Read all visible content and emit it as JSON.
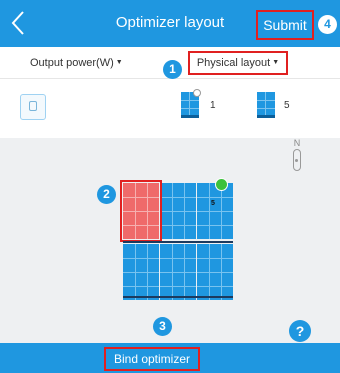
{
  "header": {
    "back_icon": "chevron-left-icon",
    "title": "Optimizer layout",
    "submit_label": "Submit",
    "badge_number": "4"
  },
  "options": {
    "output_label": "Output power(W)",
    "layout_label": "Physical layout",
    "badge_number": "1"
  },
  "toolbar": {
    "inverter_icon": "inverter-icon",
    "legend": [
      {
        "icon": "panel-with-optimizer-icon",
        "count": "1"
      },
      {
        "icon": "panel-icon",
        "count": "5"
      }
    ]
  },
  "canvas": {
    "compass_label": "N",
    "selected_badge_number": "2",
    "panel_label": "5",
    "bind_badge_number": "3",
    "help_label": "?"
  },
  "footer": {
    "bind_label": "Bind optimizer"
  },
  "colors": {
    "primary": "#1f97e0",
    "annotation_red": "#e02020",
    "selected_panel": "#ef6a6a",
    "status_green": "#3cc13c"
  }
}
